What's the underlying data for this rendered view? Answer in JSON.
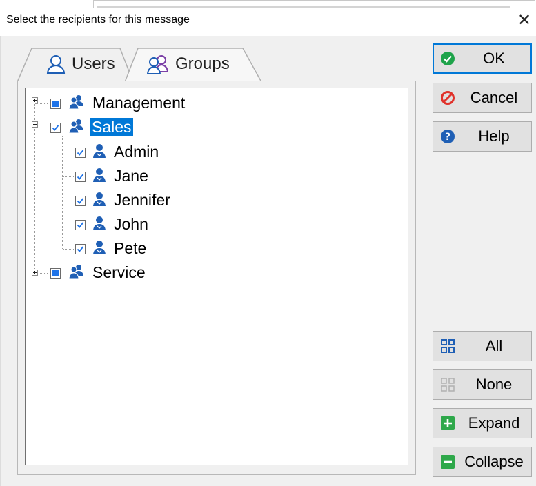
{
  "dialog": {
    "title": "Select the recipients for this message",
    "close_glyph": "✕"
  },
  "tabs": [
    {
      "label": "Users",
      "icon": "user-icon",
      "selected": false
    },
    {
      "label": "Groups",
      "icon": "group-icon",
      "selected": true
    }
  ],
  "tree": {
    "nodes": [
      {
        "label": "Management",
        "type": "group",
        "checked": "partial",
        "expanded": false
      },
      {
        "label": "Sales",
        "type": "group",
        "checked": true,
        "expanded": true,
        "selected": true,
        "children": [
          {
            "label": "Admin",
            "type": "user",
            "checked": true
          },
          {
            "label": "Jane",
            "type": "user",
            "checked": true
          },
          {
            "label": "Jennifer",
            "type": "user",
            "checked": true
          },
          {
            "label": "John",
            "type": "user",
            "checked": true
          },
          {
            "label": "Pete",
            "type": "user",
            "checked": true
          }
        ]
      },
      {
        "label": "Service",
        "type": "group",
        "checked": "partial",
        "expanded": false
      }
    ]
  },
  "buttons": {
    "ok": "OK",
    "cancel": "Cancel",
    "help": "Help",
    "all": "All",
    "none": "None",
    "expand": "Expand",
    "collapse": "Collapse"
  },
  "colors": {
    "selection": "#0078d7",
    "checkbox_fill": "#1e73e8",
    "ok_green": "#1ea34a",
    "cancel_red": "#e0322b",
    "help_blue": "#1f5fb5",
    "expand_green": "#2ea84a",
    "user_blue": "#1f5fb5",
    "group_purple": "#7b3fa6"
  }
}
